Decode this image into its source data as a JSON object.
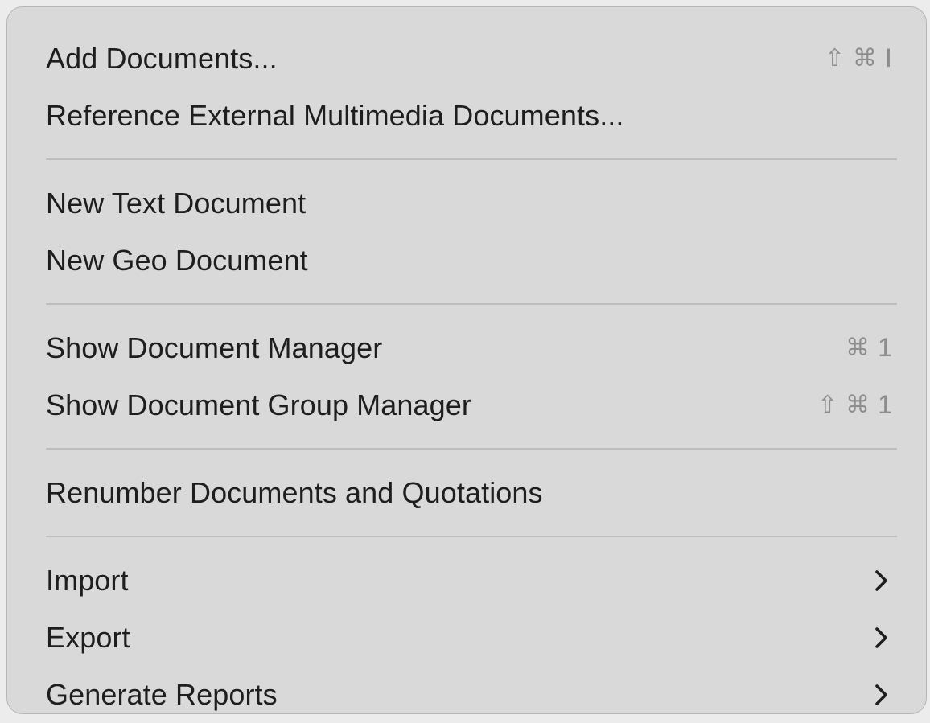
{
  "menu": {
    "items": [
      {
        "label": "Add Documents...",
        "shortcut_mods": "⇧ ⌘",
        "shortcut_key": "I"
      },
      {
        "label": "Reference External Multimedia Documents..."
      },
      {
        "label": "New Text Document"
      },
      {
        "label": "New Geo Document"
      },
      {
        "label": "Show Document Manager",
        "shortcut_mods": "⌘",
        "shortcut_key": "1"
      },
      {
        "label": "Show Document Group Manager",
        "shortcut_mods": "⇧ ⌘",
        "shortcut_key": "1"
      },
      {
        "label": "Renumber Documents and Quotations"
      },
      {
        "label": "Import",
        "submenu_icon": "chevron-right-icon"
      },
      {
        "label": "Export",
        "submenu_icon": "chevron-right-icon"
      },
      {
        "label": "Generate Reports",
        "submenu_icon": "chevron-right-icon"
      }
    ]
  },
  "colors": {
    "menu_background": "#d9d9d9",
    "text": "#1e1e1e",
    "shortcut_text": "#8d8d8d",
    "separator": "#bdbdbd"
  }
}
